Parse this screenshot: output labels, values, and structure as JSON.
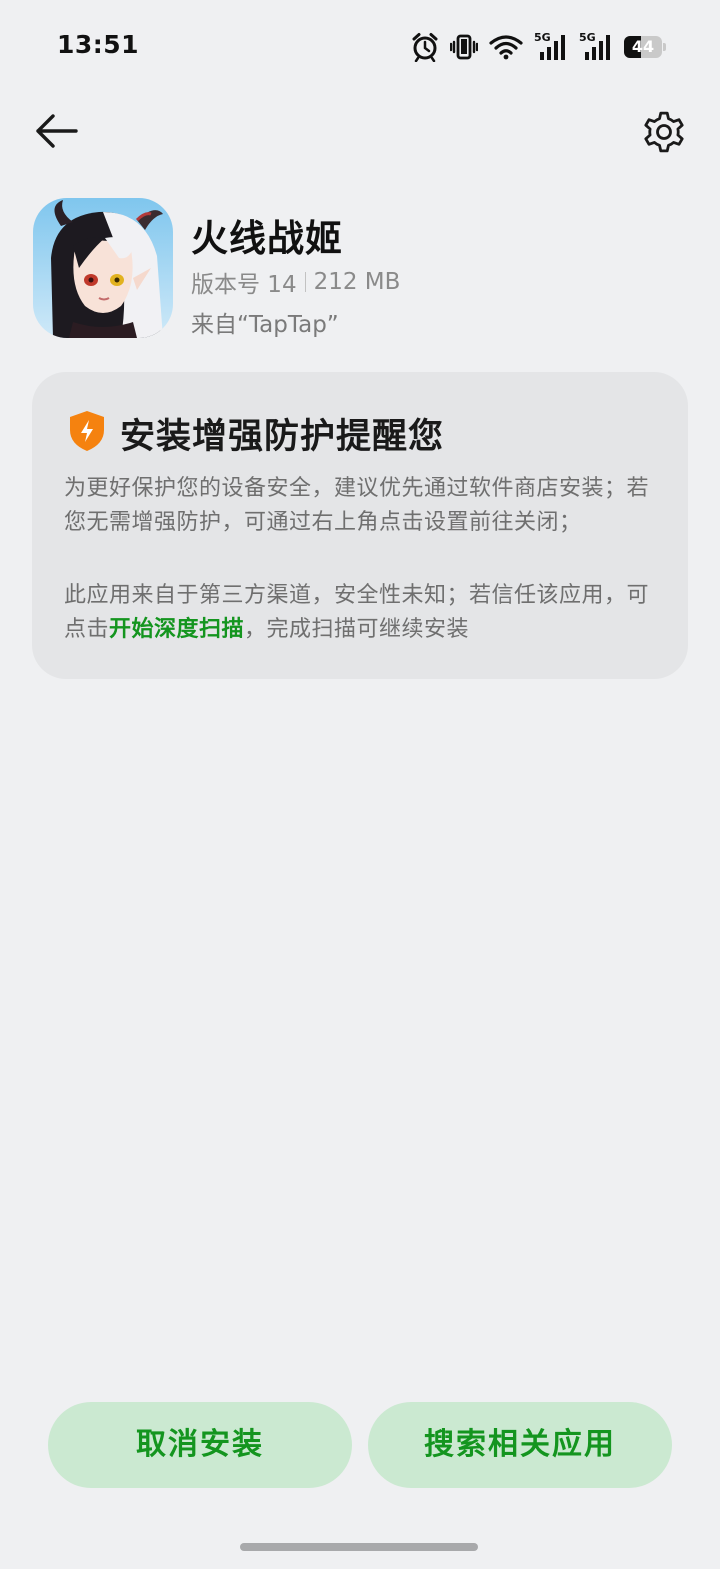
{
  "status_bar": {
    "time": "13:51",
    "network_label_1": "5G",
    "network_label_2": "5G",
    "battery_percent": 44,
    "battery_text": "44",
    "icons": [
      "alarm-icon",
      "vibrate-icon",
      "wifi-icon",
      "signal-5g-icon",
      "signal-5g-icon",
      "battery-icon"
    ]
  },
  "header": {
    "back_icon": "arrow-left-icon",
    "settings_icon": "gear-icon"
  },
  "app": {
    "name": "火线战姬",
    "version": "版本号 14",
    "size": "212 MB",
    "source": "来自“TapTap”"
  },
  "warning": {
    "icon": "shield-bolt-icon",
    "title": "安装增强防护提醒您",
    "paragraph1": "为更好保护您的设备安全，建议优先通过软件商店安装；若您无需增强防护，可通过右上角点击设置前往关闭；",
    "paragraph2_prefix": "此应用来自于第三方渠道，安全性未知；若信任该应用，可点击",
    "scan_link": "开始深度扫描",
    "paragraph2_suffix": "，完成扫描可继续安装"
  },
  "actions": {
    "cancel_label": "取消安装",
    "search_label": "搜索相关应用"
  },
  "colors": {
    "background": "#eff0f2",
    "card": "#e4e5e7",
    "accent_green": "#14951f",
    "button_bg": "#cbe9d1",
    "shield_orange": "#f5820f"
  }
}
